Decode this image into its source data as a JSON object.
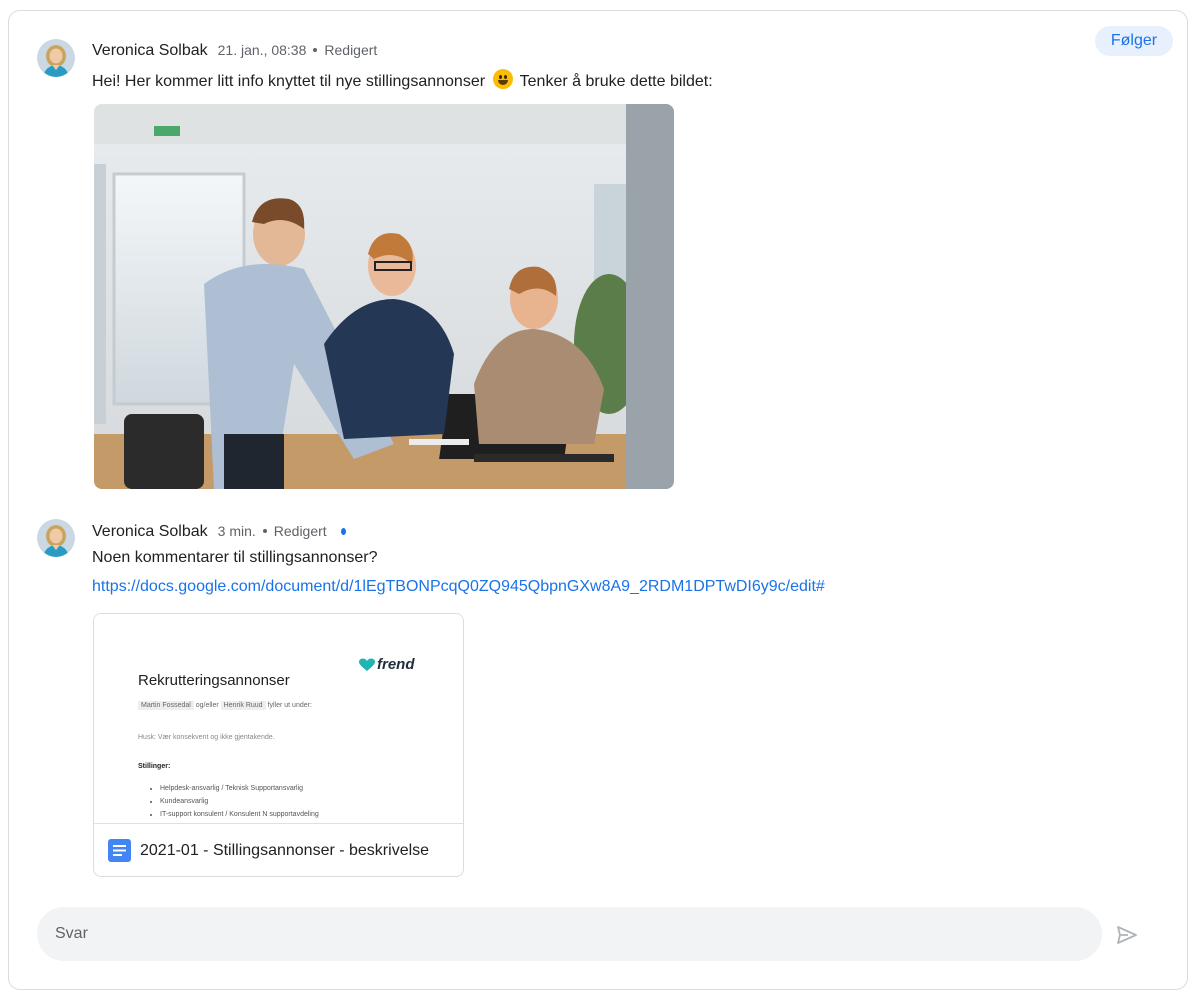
{
  "header": {
    "follow_label": "Følger"
  },
  "messages": [
    {
      "author": "Veronica Solbak",
      "time": "21. jan., 08:38",
      "edited": "Redigert",
      "text_before": "Hei! Her kommer litt info knyttet til nye stillingsannonser",
      "text_after": "Tenker å bruke dette bildet:"
    },
    {
      "author": "Veronica Solbak",
      "time": "3 min.",
      "edited": "Redigert",
      "text": "Noen kommentarer til stillingsannonser?",
      "link": "https://docs.google.com/document/d/1lEgTBONPcqQ0ZQ945QbpnGXw8A9_2RDM1DPTwDI6y9c/edit#",
      "attachment": {
        "title": "2021-01 - Stillingsannonser - beskrivelse",
        "preview": {
          "brand": "frend",
          "heading": "Rekrutteringsannonser",
          "chip1": "Martin Fossedal",
          "chip_joiner": "og/eller",
          "chip2": "Henrik Ruud",
          "chip_suffix": "fyller ut under:",
          "note": "Husk: Vær konsekvent og ikke gjentakende.",
          "section": "Stillinger:",
          "items": [
            "Helpdesk-ansvarlig / Teknisk Supportansvarlig",
            "Kundeansvarlig",
            "IT-support konsulent / Konsulent N supportavdeling"
          ]
        }
      }
    }
  ],
  "reply": {
    "placeholder": "Svar"
  },
  "icons": {
    "avatar": "person-avatar",
    "doc": "google-docs-icon",
    "send": "send-icon",
    "emoji": "grinning-face-emoji"
  },
  "colors": {
    "accent": "#1a73e8",
    "chip_bg": "#e8f0fe",
    "doc_blue": "#4285f4",
    "brand_teal": "#1fb5b5"
  }
}
